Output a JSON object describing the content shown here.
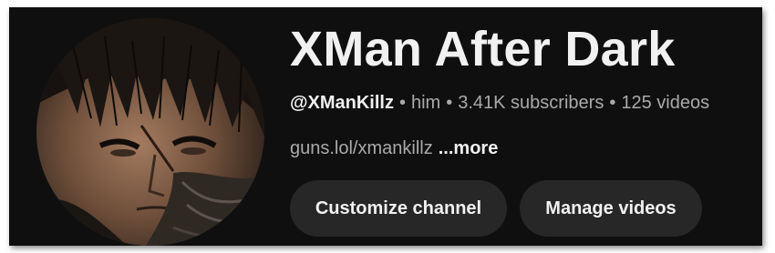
{
  "channel": {
    "name": "XMan After Dark",
    "handle": "@XManKillz",
    "pronouns": "him",
    "subscribers": "3.41K subscribers",
    "videos": "125 videos",
    "link": "guns.lol/xmankillz",
    "more_label": "...more",
    "meta_separator": "•"
  },
  "actions": {
    "customize_label": "Customize channel",
    "manage_label": "Manage videos"
  },
  "colors": {
    "background": "#0f0f0f",
    "button_bg": "#272727",
    "primary_text": "#f1f1f1",
    "secondary_text": "#aaaaaa"
  }
}
